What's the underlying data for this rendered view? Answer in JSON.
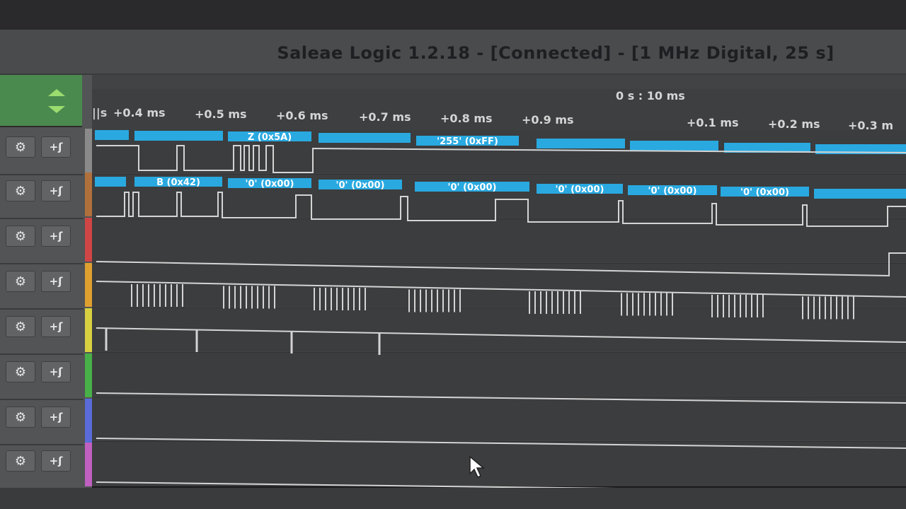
{
  "window": {
    "title": "Saleae Logic 1.2.18 - [Connected] - [1 MHz Digital, 25 s]"
  },
  "timeline": {
    "center_label": "0 s : 10 ms",
    "left_mark": "||s",
    "ticks": [
      "+0.4 ms",
      "+0.5 ms",
      "+0.6 ms",
      "+0.7 ms",
      "+0.8 ms",
      "+0.9 ms",
      "+0.1 ms",
      "+0.2 ms",
      "+0.3 m"
    ]
  },
  "channels": [
    {
      "gear_icon": "gear-icon",
      "trigger_icon": "trigger-rising-icon",
      "gear_glyph": "⚙",
      "trigger_glyph": "+ʃ",
      "color": "#8a8a8a",
      "annotations": [
        "Z (0x5A)",
        "'255' (0xFF)"
      ]
    },
    {
      "gear_glyph": "⚙",
      "trigger_glyph": "+ʃ",
      "color": "#b0703c",
      "annotations": [
        "B (0x42)",
        "'0' (0x00)",
        "'0' (0x00)",
        "'0' (0x00)",
        "'0' (0x00)",
        "'0' (0x00)",
        "'0' (0x00)"
      ]
    },
    {
      "gear_glyph": "⚙",
      "trigger_glyph": "+ʃ",
      "color": "#d04545"
    },
    {
      "gear_glyph": "⚙",
      "trigger_glyph": "+ʃ",
      "color": "#e0a030"
    },
    {
      "gear_glyph": "⚙",
      "trigger_glyph": "+ʃ",
      "color": "#d8d040"
    },
    {
      "gear_glyph": "⚙",
      "trigger_glyph": "+ʃ",
      "color": "#48b048"
    },
    {
      "gear_glyph": "⚙",
      "trigger_glyph": "+ʃ",
      "color": "#5a6ad8"
    },
    {
      "gear_glyph": "⚙",
      "trigger_glyph": "+ʃ",
      "color": "#c060c0"
    }
  ],
  "colors": {
    "annotation": "#29a9e0",
    "trace": "#d4d4d4",
    "grid": "#48494b",
    "row_bg": "#3c3d3f"
  }
}
